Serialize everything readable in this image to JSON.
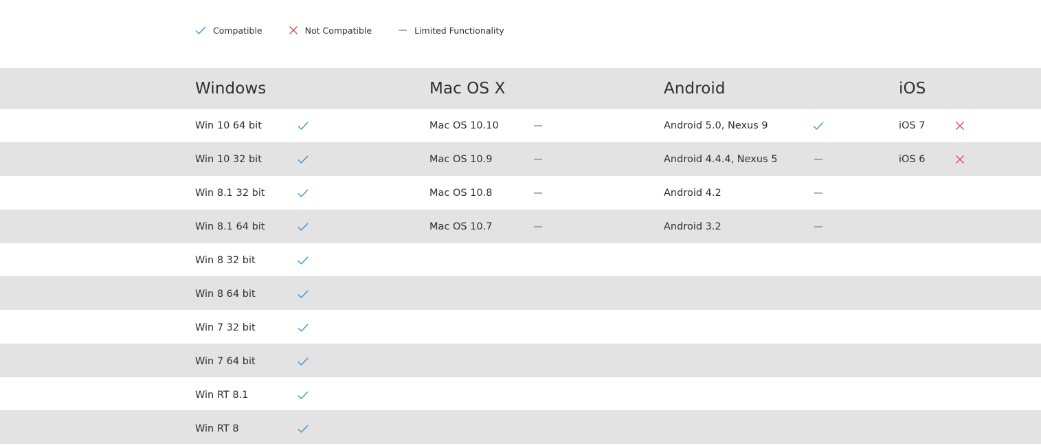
{
  "legend": [
    {
      "icon": "check-icon",
      "label": "Compatible"
    },
    {
      "icon": "cross-icon",
      "label": "Not Compatible"
    },
    {
      "icon": "dash-icon",
      "label": "Limited Functionality"
    }
  ],
  "colors": {
    "check": "#2e8fd6",
    "cross": "#d9453c",
    "dash": "#7a7a7a",
    "stripe": "#e3e3e3"
  },
  "columns": [
    {
      "title": "Windows",
      "rows": [
        {
          "label": "Win 10 64 bit",
          "status": "compatible"
        },
        {
          "label": "Win 10 32 bit",
          "status": "compatible"
        },
        {
          "label": "Win 8.1 32 bit",
          "status": "compatible"
        },
        {
          "label": "Win 8.1 64 bit",
          "status": "compatible"
        },
        {
          "label": "Win 8 32 bit",
          "status": "compatible"
        },
        {
          "label": "Win 8 64 bit",
          "status": "compatible"
        },
        {
          "label": "Win 7 32 bit",
          "status": "compatible"
        },
        {
          "label": "Win 7 64 bit",
          "status": "compatible"
        },
        {
          "label": "Win RT 8.1",
          "status": "compatible"
        },
        {
          "label": "Win RT 8",
          "status": "compatible"
        }
      ]
    },
    {
      "title": "Mac OS X",
      "rows": [
        {
          "label": "Mac OS 10.10",
          "status": "limited"
        },
        {
          "label": "Mac OS 10.9",
          "status": "limited"
        },
        {
          "label": "Mac OS 10.8",
          "status": "limited"
        },
        {
          "label": "Mac OS 10.7",
          "status": "limited"
        }
      ]
    },
    {
      "title": "Android",
      "rows": [
        {
          "label": "Android 5.0, Nexus 9",
          "status": "compatible"
        },
        {
          "label": "Android 4.4.4, Nexus 5",
          "status": "limited"
        },
        {
          "label": "Android 4.2",
          "status": "limited"
        },
        {
          "label": "Android 3.2",
          "status": "limited"
        }
      ]
    },
    {
      "title": "iOS",
      "rows": [
        {
          "label": "iOS 7",
          "status": "not-compatible"
        },
        {
          "label": "iOS 6",
          "status": "not-compatible"
        }
      ]
    }
  ]
}
